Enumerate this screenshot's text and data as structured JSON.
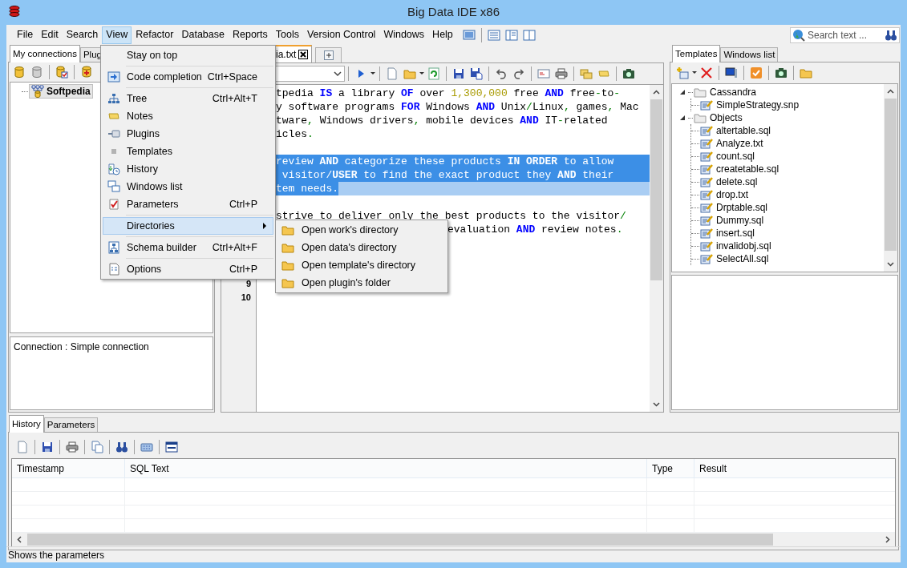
{
  "window": {
    "title": "Big Data IDE x86"
  },
  "menu_bar": [
    {
      "label": "File",
      "selected": false
    },
    {
      "label": "Edit",
      "selected": false
    },
    {
      "label": "Search",
      "selected": false
    },
    {
      "label": "View",
      "selected": true
    },
    {
      "label": "Refactor",
      "selected": false
    },
    {
      "label": "Database",
      "selected": false
    },
    {
      "label": "Reports",
      "selected": false
    },
    {
      "label": "Tools",
      "selected": false
    },
    {
      "label": "Version Control",
      "selected": false
    },
    {
      "label": "Windows",
      "selected": false
    },
    {
      "label": "Help",
      "selected": false
    }
  ],
  "search": {
    "placeholder": "Search text ..."
  },
  "left_panel": {
    "tabs": [
      {
        "label": "My connections",
        "selected": true
      },
      {
        "label": "Plug",
        "selected": false
      }
    ],
    "tree": [
      {
        "label": "Softpedia",
        "selected": true
      }
    ],
    "connection_info": "Connection : Simple connection"
  },
  "editor": {
    "tabs": [
      {
        "label": "ia.txt",
        "selected": true
      }
    ],
    "rows": [
      {
        "selected": false,
        "segments": [
          {
            "text": "tpedia ",
            "kind": "text"
          },
          {
            "text": "IS",
            "kind": "kw"
          },
          {
            "text": " a library ",
            "kind": "text"
          },
          {
            "text": "OF",
            "kind": "kw"
          },
          {
            "text": " over ",
            "kind": "text"
          },
          {
            "text": "1,300,000",
            "kind": "num"
          },
          {
            "text": " free ",
            "kind": "text"
          },
          {
            "text": "AND",
            "kind": "kw"
          },
          {
            "text": " free",
            "kind": "text"
          },
          {
            "text": "-",
            "kind": "sym"
          },
          {
            "text": "to",
            "kind": "text"
          },
          {
            "text": "-",
            "kind": "sym"
          }
        ]
      },
      {
        "selected": false,
        "segments": [
          {
            "text": "y software programs ",
            "kind": "text"
          },
          {
            "text": "FOR",
            "kind": "kw"
          },
          {
            "text": " Windows ",
            "kind": "text"
          },
          {
            "text": "AND",
            "kind": "kw"
          },
          {
            "text": " Unix",
            "kind": "text"
          },
          {
            "text": "/",
            "kind": "sym"
          },
          {
            "text": "Linux",
            "kind": "text"
          },
          {
            "text": ",",
            "kind": "sym"
          },
          {
            "text": " games",
            "kind": "text"
          },
          {
            "text": ",",
            "kind": "sym"
          },
          {
            "text": " Mac",
            "kind": "text"
          }
        ]
      },
      {
        "selected": false,
        "segments": [
          {
            "text": "tware",
            "kind": "text"
          },
          {
            "text": ",",
            "kind": "sym"
          },
          {
            "text": " Windows drivers",
            "kind": "text"
          },
          {
            "text": ",",
            "kind": "sym"
          },
          {
            "text": " mobile devices ",
            "kind": "text"
          },
          {
            "text": "AND",
            "kind": "kw"
          },
          {
            "text": " IT",
            "kind": "text"
          },
          {
            "text": "-",
            "kind": "sym"
          },
          {
            "text": "related",
            "kind": "text"
          }
        ]
      },
      {
        "selected": false,
        "segments": [
          {
            "text": "icles",
            "kind": "text"
          },
          {
            "text": ".",
            "kind": "sym"
          }
        ]
      },
      {
        "selected": false
      },
      {
        "selected": true,
        "segments": [
          {
            "text": "review ",
            "kind": "text"
          },
          {
            "text": "AND",
            "kind": "kw"
          },
          {
            "text": " categorize these products ",
            "kind": "text"
          },
          {
            "text": "IN ORDER",
            "kind": "kw"
          },
          {
            "text": " to allow",
            "kind": "text"
          }
        ]
      },
      {
        "selected": true,
        "segments": [
          {
            "text": " visitor",
            "kind": "text"
          },
          {
            "text": "/",
            "kind": "sym"
          },
          {
            "text": "USER",
            "kind": "kw"
          },
          {
            "text": " to find the exact product they ",
            "kind": "text"
          },
          {
            "text": "AND",
            "kind": "kw"
          },
          {
            "text": " their",
            "kind": "text"
          }
        ]
      },
      {
        "selected": true,
        "segments": [
          {
            "text": "tem needs",
            "kind": "text"
          },
          {
            "text": ".",
            "kind": "sym"
          }
        ]
      },
      {
        "selected": false
      },
      {
        "selected": false,
        "segments": [
          {
            "text": "strive to deliver only the best products to the visitor",
            "kind": "text"
          },
          {
            "text": "/",
            "kind": "sym"
          }
        ]
      },
      {
        "selected": false,
        "segments": [
          {
            "text": "evaluation ",
            "kind": "text"
          },
          {
            "text": "AND",
            "kind": "kw"
          },
          {
            "text": " review notes",
            "kind": "text"
          },
          {
            "text": ".",
            "kind": "sym"
          }
        ]
      },
      {
        "selected": false
      },
      {
        "selected": false
      },
      {
        "selected": false
      },
      {
        "selected": false,
        "number": "9"
      },
      {
        "selected": false,
        "number": "10"
      }
    ]
  },
  "right_panel": {
    "tabs": [
      {
        "label": "Templates",
        "selected": true
      },
      {
        "label": "Windows list",
        "selected": false
      }
    ],
    "tree": [
      {
        "label": "Cassandra",
        "expanded": true,
        "children": [
          {
            "label": "SimpleStrategy.snp"
          }
        ]
      },
      {
        "label": "Objects",
        "expanded": true,
        "children": [
          {
            "label": "altertable.sql"
          },
          {
            "label": "Analyze.txt"
          },
          {
            "label": "count.sql"
          },
          {
            "label": "createtable.sql"
          },
          {
            "label": "delete.sql"
          },
          {
            "label": "drop.txt"
          },
          {
            "label": "Drptable.sql"
          },
          {
            "label": "Dummy.sql"
          },
          {
            "label": "insert.sql"
          },
          {
            "label": "invalidobj.sql"
          },
          {
            "label": "SelectAll.sql"
          }
        ]
      }
    ]
  },
  "bottom_panel": {
    "tabs": [
      {
        "label": "History",
        "selected": true
      },
      {
        "label": "Parameters",
        "selected": false
      }
    ],
    "table": {
      "columns": [
        "Timestamp",
        "SQL Text",
        "Type",
        "Result"
      ]
    }
  },
  "view_menu": {
    "items": [
      {
        "kind": "item",
        "label": "Stay on top",
        "selected": false
      },
      {
        "kind": "separator"
      },
      {
        "kind": "item",
        "label": "Code completion",
        "shortcut": "Ctrl+Space",
        "selected": false
      },
      {
        "kind": "separator"
      },
      {
        "kind": "item",
        "label": "Tree",
        "shortcut": "Ctrl+Alt+T",
        "selected": false
      },
      {
        "kind": "item",
        "label": "Notes",
        "selected": false
      },
      {
        "kind": "item",
        "label": "Plugins",
        "selected": false
      },
      {
        "kind": "item",
        "label": "Templates",
        "selected": false
      },
      {
        "kind": "item",
        "label": "History",
        "selected": false
      },
      {
        "kind": "item",
        "label": "Windows list",
        "selected": false
      },
      {
        "kind": "item",
        "label": "Parameters",
        "shortcut": "Ctrl+P",
        "selected": false
      },
      {
        "kind": "separator"
      },
      {
        "kind": "submenu",
        "label": "Directories",
        "selected": true
      },
      {
        "kind": "separator"
      },
      {
        "kind": "item",
        "label": "Schema builder",
        "shortcut": "Ctrl+Alt+F",
        "selected": false
      },
      {
        "kind": "separator"
      },
      {
        "kind": "item",
        "label": "Options",
        "shortcut": "Ctrl+P",
        "selected": false
      }
    ]
  },
  "directories_submenu": {
    "items": [
      {
        "label": "Open work's directory"
      },
      {
        "label": "Open data's directory"
      },
      {
        "label": "Open template's directory"
      },
      {
        "label": "Open plugin's folder"
      }
    ]
  },
  "status_bar": "Shows the parameters"
}
